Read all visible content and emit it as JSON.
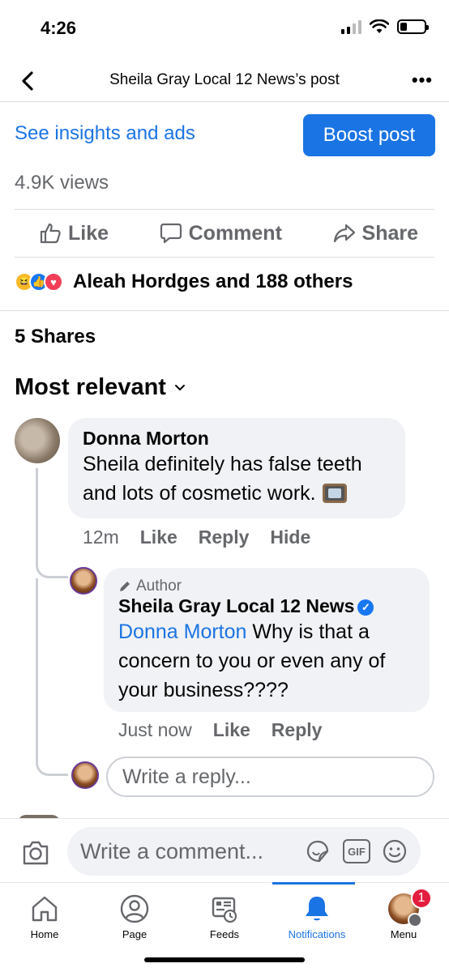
{
  "status": {
    "time": "4:26"
  },
  "header": {
    "title": "Sheila Gray Local 12 News’s post"
  },
  "post_tools": {
    "insights_link": "See insights and ads",
    "boost_button": "Boost post",
    "views": "4.9K views"
  },
  "actions": {
    "like": "Like",
    "comment": "Comment",
    "share": "Share"
  },
  "reactions": {
    "summary": "Aleah Hordges and 188 others"
  },
  "shares": "5 Shares",
  "sort": {
    "label": "Most relevant"
  },
  "comments": [
    {
      "author": "Donna Morton",
      "text": "Sheila definitely has false teeth and lots of cosmetic work.",
      "time": "12m",
      "like": "Like",
      "reply": "Reply",
      "hide": "Hide"
    }
  ],
  "reply": {
    "tag": "Author",
    "author": "Sheila Gray Local 12 News",
    "mention": "Donna Morton",
    "text": " Why is that a concern to you or even any of your business????",
    "time": "Just now",
    "like": "Like",
    "reply": "Reply"
  },
  "reply_input": {
    "placeholder": "Write a reply..."
  },
  "composer": {
    "placeholder": "Write a comment...",
    "gif": "GIF"
  },
  "tabs": [
    {
      "label": "Home"
    },
    {
      "label": "Page"
    },
    {
      "label": "Feeds"
    },
    {
      "label": "Notifications"
    },
    {
      "label": "Menu",
      "badge": "1"
    }
  ],
  "colors": {
    "accent": "#1b74e4",
    "badge": "#e41e3f",
    "bubble": "#f0f2f5",
    "muted": "#65676b"
  }
}
